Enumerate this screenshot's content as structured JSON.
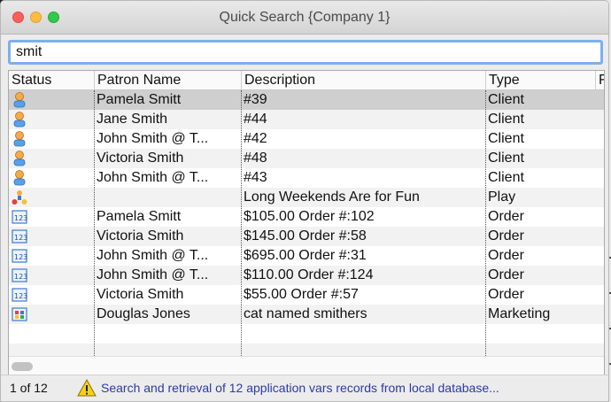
{
  "window": {
    "title": "Quick Search {Company 1}"
  },
  "search": {
    "value": "smit"
  },
  "columns": [
    "Status",
    "Patron Name",
    "Description",
    "Type",
    "F"
  ],
  "rows": [
    {
      "status_icon": "person-icon",
      "patron": "Pamela Smitt",
      "description": "#39",
      "type": "Client",
      "selected": true
    },
    {
      "status_icon": "person-icon",
      "patron": "Jane Smith",
      "description": "#44",
      "type": "Client"
    },
    {
      "status_icon": "person-icon",
      "patron": "John Smith @ T...",
      "description": "#42",
      "type": "Client"
    },
    {
      "status_icon": "person-icon",
      "patron": "Victoria Smith",
      "description": "#48",
      "type": "Client"
    },
    {
      "status_icon": "person-icon",
      "patron": "John Smith @ T...",
      "description": "#43",
      "type": "Client"
    },
    {
      "status_icon": "group-icon",
      "patron": "",
      "description": "Long Weekends Are for Fun",
      "type": "Play"
    },
    {
      "status_icon": "order-icon",
      "patron": "Pamela Smitt",
      "description": "$105.00  Order #:102",
      "type": "Order"
    },
    {
      "status_icon": "order-icon",
      "patron": "Victoria Smith",
      "description": "$145.00  Order #:58",
      "type": "Order"
    },
    {
      "status_icon": "order-icon",
      "patron": "John Smith @ T...",
      "description": "$695.00  Order #:31",
      "type": "Order"
    },
    {
      "status_icon": "order-icon",
      "patron": "John Smith @ T...",
      "description": "$110.00  Order #:124",
      "type": "Order"
    },
    {
      "status_icon": "order-icon",
      "patron": "Victoria Smith",
      "description": "$55.00  Order #:57",
      "type": "Order"
    },
    {
      "status_icon": "marketing-icon",
      "patron": "Douglas Jones",
      "description": "cat named smithers",
      "type": "Marketing"
    }
  ],
  "status": {
    "count": "1 of 12",
    "message": "Search and retrieval of 12 application vars records from local database..."
  },
  "colors": {
    "accent": "#7eaef0",
    "link": "#2b3aa8",
    "selected": "#cfcfcf"
  }
}
